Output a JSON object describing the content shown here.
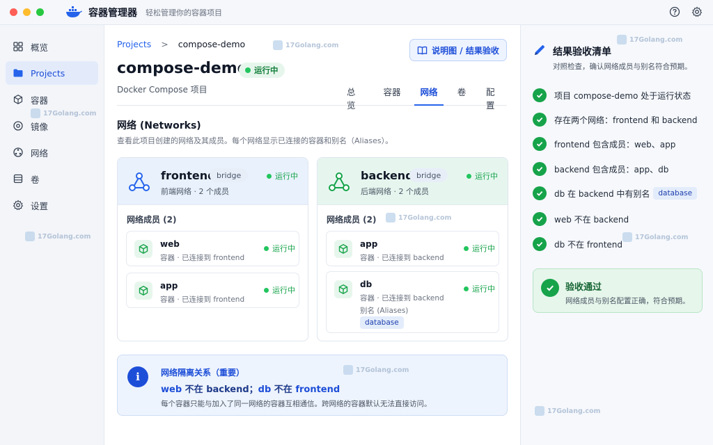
{
  "app": {
    "title": "容器管理器",
    "subtitle": "轻松管理你的容器项目"
  },
  "sidebar": {
    "items": [
      {
        "label": "概览",
        "icon": "overview-icon"
      },
      {
        "label": "Projects",
        "icon": "folder-icon",
        "active": true
      },
      {
        "label": "容器",
        "icon": "cube-icon"
      },
      {
        "label": "镜像",
        "icon": "image-icon"
      },
      {
        "label": "网络",
        "icon": "network-icon"
      },
      {
        "label": "卷",
        "icon": "volume-icon"
      },
      {
        "label": "设置",
        "icon": "gear-icon"
      }
    ]
  },
  "main": {
    "breadcrumb": {
      "root": "Projects",
      "separator": ">",
      "current": "compose-demo"
    },
    "title": "compose-demo",
    "status": "运行中",
    "subtitle": "Docker Compose 项目",
    "doc_button": "说明图 / 结果验收",
    "tabs": [
      {
        "label": "总览"
      },
      {
        "label": "容器"
      },
      {
        "label": "网络",
        "active": true
      },
      {
        "label": "卷"
      },
      {
        "label": "配置"
      }
    ],
    "section_title": "网络 (Networks)",
    "section_desc": "查看此项目创建的网络及其成员。每个网络显示已连接的容器和别名（Aliases）。",
    "networks": [
      {
        "name": "frontend",
        "driver": "bridge",
        "status": "运行中",
        "meta": "前端网络 · 2 个成员",
        "members_title": "网络成员 (2)",
        "members": [
          {
            "name": "web",
            "desc": "容器 · 已连接到 frontend",
            "status": "运行中"
          },
          {
            "name": "app",
            "desc": "容器 · 已连接到 frontend",
            "status": "运行中"
          }
        ]
      },
      {
        "name": "backend",
        "driver": "bridge",
        "status": "运行中",
        "meta": "后端网络 · 2 个成员",
        "members_title": "网络成员 (2)",
        "members": [
          {
            "name": "app",
            "desc": "容器 · 已连接到 backend",
            "status": "运行中"
          },
          {
            "name": "db",
            "desc": "容器 · 已连接到 backend",
            "status": "运行中",
            "alias_label": "别名 (Aliases)",
            "alias": "database"
          }
        ]
      }
    ],
    "info": {
      "title": "网络隔离关系（重要）",
      "line_a_name": "web",
      "line_a_text": " 不在 backend；",
      "line_b_name": "db",
      "line_b_text": " 不在 ",
      "line_b_net": "frontend",
      "desc": "每个容器只能与加入了同一网络的容器互相通信。跨网络的容器默认无法直接访问。"
    }
  },
  "checklist": {
    "title": "结果验收清单",
    "subtitle": "对照检查，确认网络成员与别名符合预期。",
    "items": [
      {
        "text": "项目 compose-demo 处于运行状态"
      },
      {
        "text": "存在两个网络：frontend 和 backend"
      },
      {
        "text": "frontend 包含成员：web、app"
      },
      {
        "text": "backend 包含成员：app、db"
      },
      {
        "text": "db 在 backend 中有别名",
        "tag": "database"
      },
      {
        "text": "web 不在 backend"
      },
      {
        "text": "db 不在 frontend"
      }
    ],
    "result_title": "验收通过",
    "result_desc": "网络成员与别名配置正确，符合预期。"
  },
  "watermark": "17Golang.com",
  "colors": {
    "accent": "#2563eb",
    "success": "#16a34a",
    "frontend_head": "#e8f1fc",
    "backend_head": "#e6f6ef"
  }
}
